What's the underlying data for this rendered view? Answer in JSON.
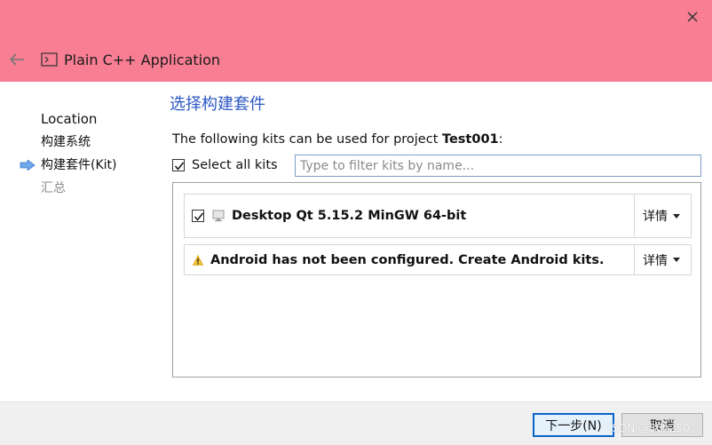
{
  "window": {
    "title": "Plain C++ Application",
    "titlebar_color": "#f77e93",
    "icons": {
      "close": "close-icon",
      "back": "back-arrow-icon",
      "app": "terminal-icon"
    }
  },
  "steps": {
    "items": [
      "Location",
      "构建系统",
      "构建套件(Kit)",
      "汇总"
    ],
    "current_index": 2,
    "current_indicator": "right-arrow-icon"
  },
  "page": {
    "title": "选择构建套件",
    "intro_prefix": "The following kits can be used for project ",
    "project_name": "Test001",
    "intro_suffix": ":"
  },
  "select_all": {
    "label": "Select all kits",
    "checked": true
  },
  "filter": {
    "placeholder": "Type to filter kits by name...",
    "value": ""
  },
  "kits": [
    {
      "name": "Desktop Qt 5.15.2 MinGW 64-bit",
      "checked": true,
      "icon": "monitor-icon",
      "details_label": "详情"
    }
  ],
  "warning": {
    "text": "Android has not been configured. Create Android kits.",
    "icon": "warning-icon",
    "details_label": "详情"
  },
  "buttons": {
    "next": "下一步(N)",
    "cancel": "取消"
  },
  "watermark": "CSDN @86h250",
  "colors": {
    "accent": "#2e59c4",
    "primary_button_border": "#0a64c8"
  }
}
